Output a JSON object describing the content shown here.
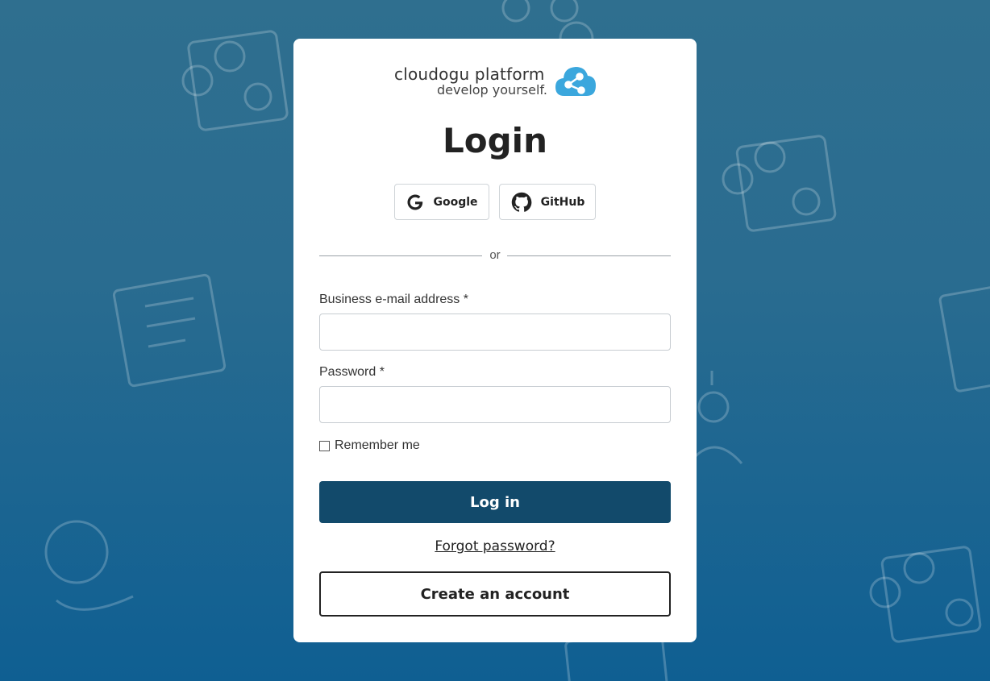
{
  "brand": {
    "name": "cloudogu platform",
    "tagline": "develop yourself.",
    "accent_color": "#3ba7dd"
  },
  "page_title": "Login",
  "sso": {
    "google_label": "Google",
    "github_label": "GitHub"
  },
  "divider_text": "or",
  "form": {
    "email_label": "Business e-mail address *",
    "email_value": "",
    "password_label": "Password *",
    "password_value": "",
    "remember_label": "Remember me",
    "remember_checked": false
  },
  "actions": {
    "login_label": "Log in",
    "forgot_label": "Forgot password?",
    "create_label": "Create an account"
  },
  "colors": {
    "primary_button": "#124a6b",
    "background_top": "#2f6f8f",
    "background_bottom": "#0f5f92"
  },
  "icons": [
    "google-icon",
    "github-icon",
    "cloud-share-icon",
    "checkbox-icon"
  ]
}
